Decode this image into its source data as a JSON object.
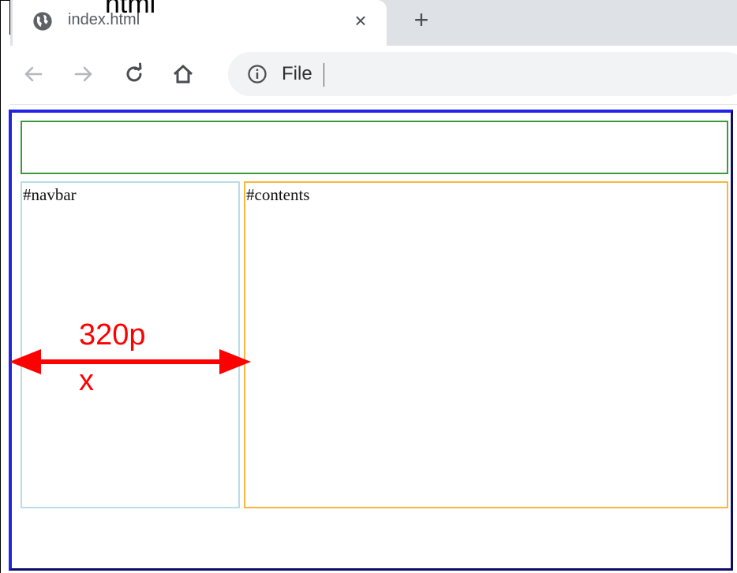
{
  "browser": {
    "tab": {
      "title": "index.html",
      "favicon": "globe-icon",
      "close_glyph": "×"
    },
    "new_tab_glyph": "+",
    "toolbar": {
      "back_icon": "arrow-left-icon",
      "forward_icon": "arrow-right-icon",
      "reload_icon": "reload-icon",
      "home_icon": "home-icon"
    },
    "omnibox": {
      "security_icon": "info-icon",
      "text": "File"
    }
  },
  "overlay": {
    "label": "html"
  },
  "page": {
    "wrapper_color": "#2323e6",
    "header": {
      "label": "",
      "border_color": "#3c9a3c"
    },
    "navbar": {
      "label": "#navbar",
      "border_color": "#b9dde6"
    },
    "contents": {
      "label": "#contents",
      "border_color": "#f6b83c"
    }
  },
  "annotation": {
    "line1": "320p",
    "line2": "x",
    "color": "#ff0000"
  }
}
